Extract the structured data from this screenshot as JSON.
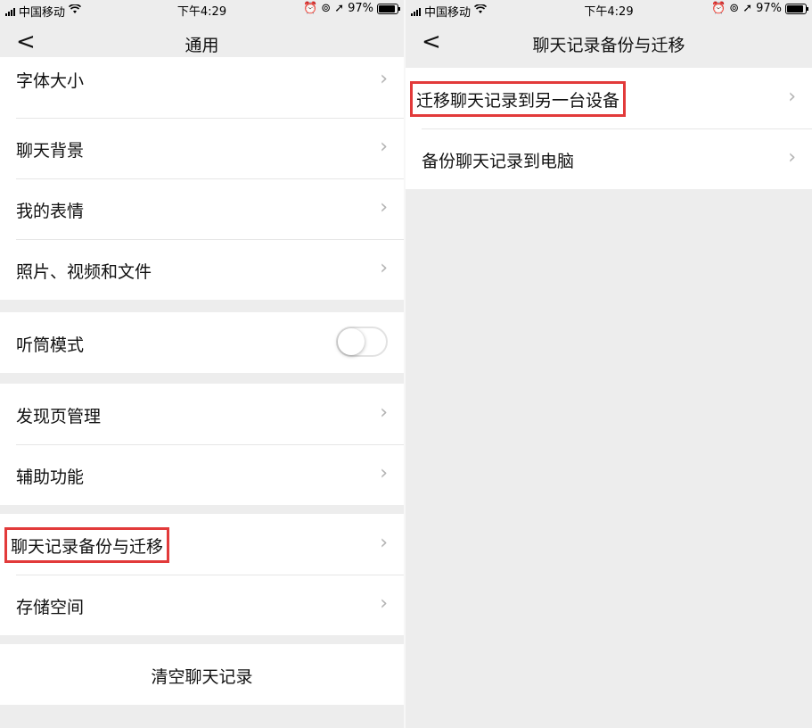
{
  "status": {
    "carrier": "中国移动",
    "time": "下午4:29",
    "battery": "97%",
    "wifi_icon": "wifi-icon",
    "alarm_icon": "alarm-icon",
    "location_icon": "location-icon"
  },
  "left": {
    "title": "通用",
    "back": "<",
    "group1": [
      "字体大小",
      "聊天背景",
      "我的表情",
      "照片、视频和文件"
    ],
    "toggle_label": "听筒模式",
    "toggle_on": false,
    "group2": [
      "发现页管理",
      "辅助功能"
    ],
    "group3": [
      "聊天记录备份与迁移",
      "存储空间"
    ],
    "clear_label": "清空聊天记录"
  },
  "right": {
    "title": "聊天记录备份与迁移",
    "back": "<",
    "items": [
      "迁移聊天记录到另一台设备",
      "备份聊天记录到电脑"
    ]
  },
  "colors": {
    "highlight": "#e23a3a",
    "background": "#ededed",
    "chevron": "#b3b3b3"
  }
}
